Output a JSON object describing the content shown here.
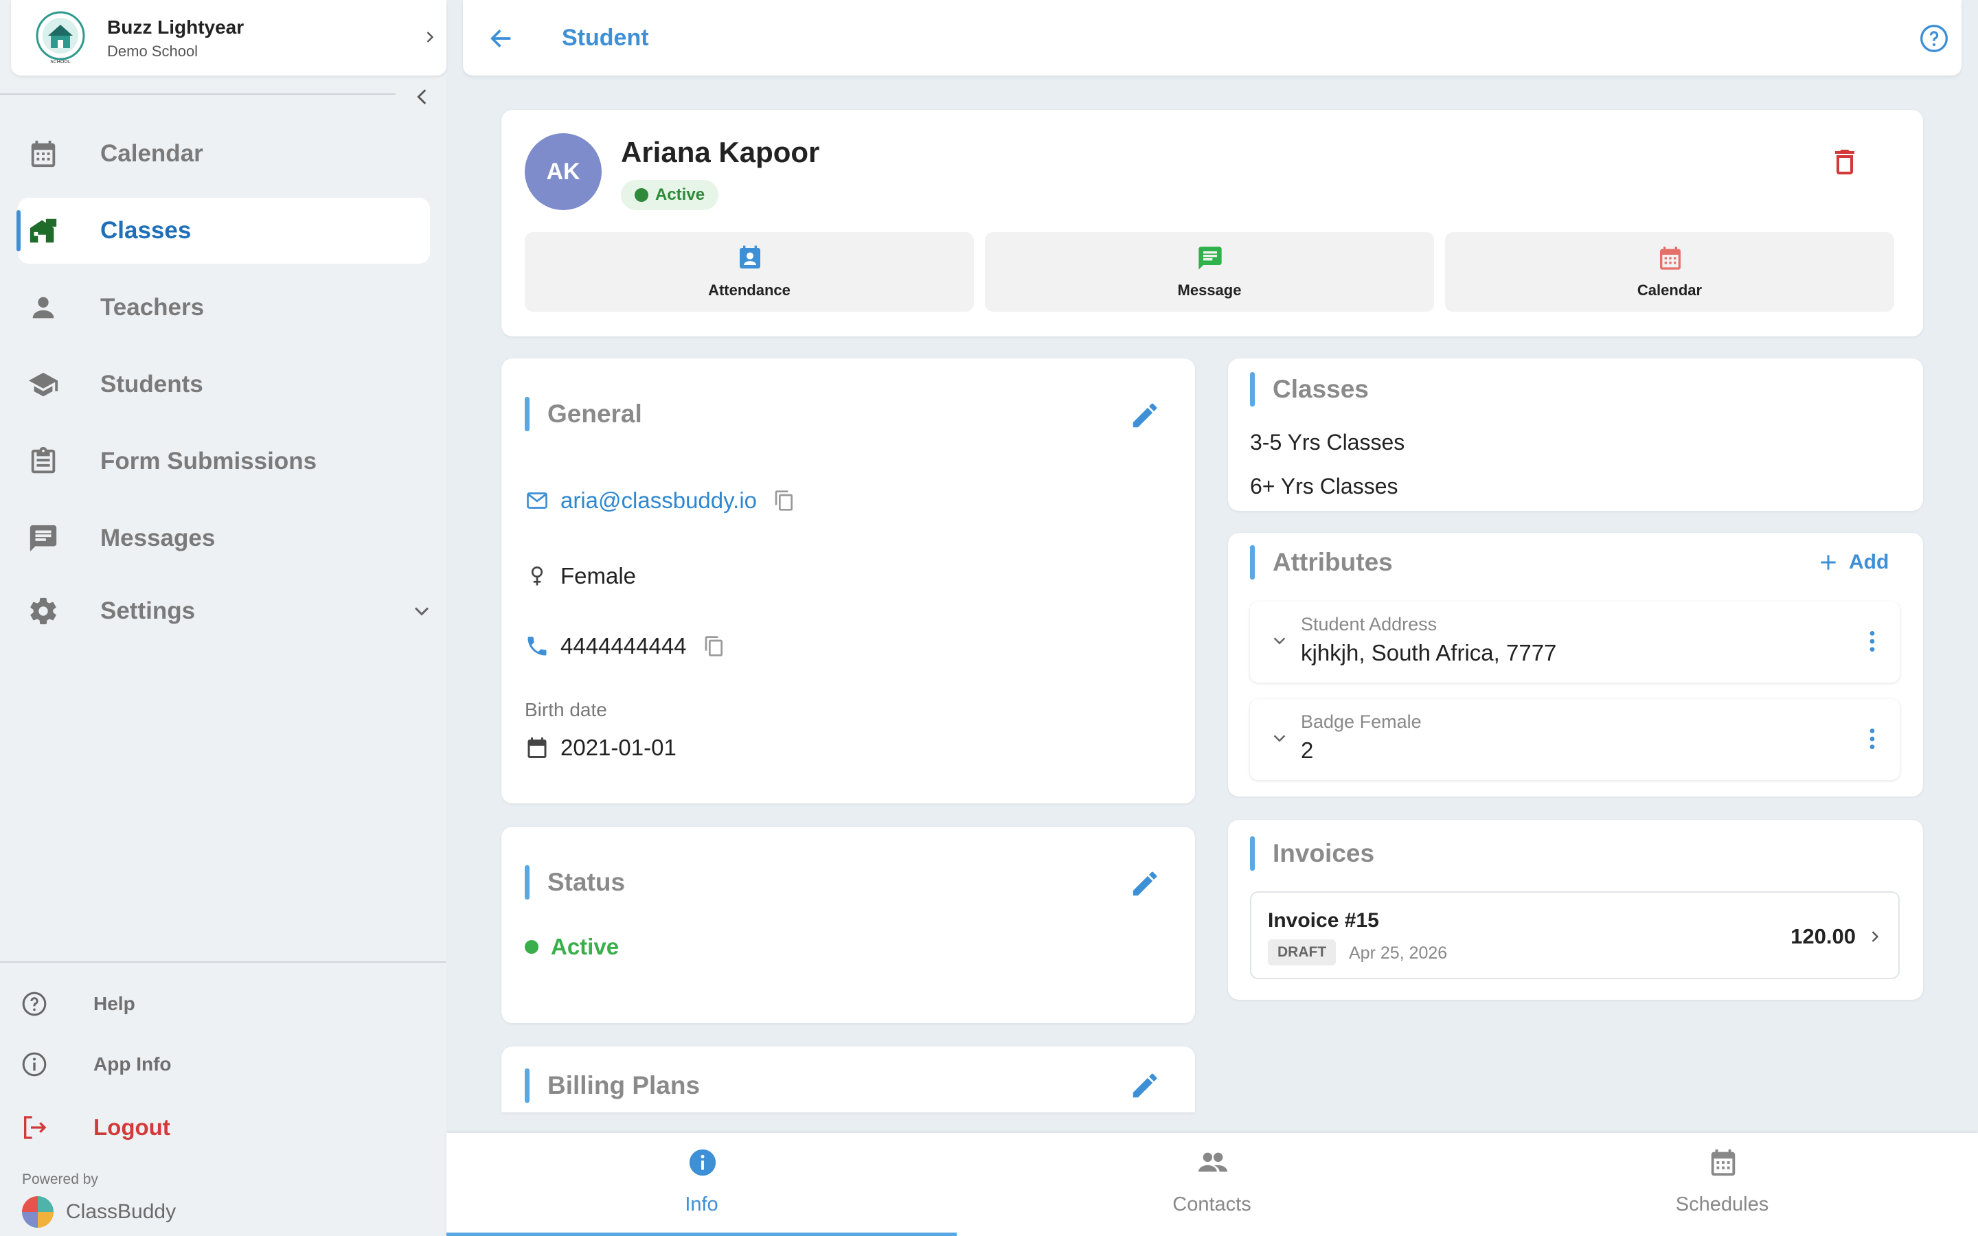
{
  "colors": {
    "accent": "#3d8fd6",
    "active_green": "#3aae4a",
    "danger": "#d23a3a",
    "avatar_bg": "#7e8ccc"
  },
  "sidebar": {
    "school_name": "Buzz Lightyear",
    "school_sub": "Demo School",
    "logo_text": "SCHOOL",
    "nav": [
      {
        "label": "Calendar",
        "icon": "calendar-icon"
      },
      {
        "label": "Classes",
        "icon": "classes-home-icon",
        "active": true
      },
      {
        "label": "Teachers",
        "icon": "person-icon"
      },
      {
        "label": "Students",
        "icon": "graduation-cap-icon"
      },
      {
        "label": "Form Submissions",
        "icon": "clipboard-icon"
      },
      {
        "label": "Messages",
        "icon": "message-icon"
      },
      {
        "label": "Settings",
        "icon": "gear-icon"
      }
    ],
    "footer": {
      "help": "Help",
      "app_info": "App Info",
      "logout": "Logout",
      "powered_by": "Powered by",
      "brand": "ClassBuddy"
    }
  },
  "topbar": {
    "title": "Student"
  },
  "profile": {
    "initials": "AK",
    "name": "Ariana Kapoor",
    "status": "Active",
    "actions": [
      {
        "label": "Attendance",
        "icon": "attendance-icon"
      },
      {
        "label": "Message",
        "icon": "message-icon"
      },
      {
        "label": "Calendar",
        "icon": "calendar-icon"
      }
    ]
  },
  "general": {
    "title": "General",
    "email": "aria@classbuddy.io",
    "gender": "Female",
    "phone": "4444444444",
    "birth_label": "Birth date",
    "birth_date": "2021-01-01"
  },
  "status_card": {
    "title": "Status",
    "value": "Active"
  },
  "billing": {
    "title": "Billing Plans"
  },
  "classes": {
    "title": "Classes",
    "items": [
      "3-5 Yrs Classes",
      "6+ Yrs Classes"
    ]
  },
  "attributes": {
    "title": "Attributes",
    "add_label": "Add",
    "items": [
      {
        "name": "Student Address",
        "value": "kjhkjh, South Africa, 7777"
      },
      {
        "name": "Badge Female",
        "value": "2"
      }
    ]
  },
  "invoices": {
    "title": "Invoices",
    "items": [
      {
        "title": "Invoice #15",
        "badge": "DRAFT",
        "date": "Apr 25, 2026",
        "amount": "120.00"
      }
    ]
  },
  "tabs": [
    {
      "label": "Info",
      "icon": "info-icon",
      "active": true
    },
    {
      "label": "Contacts",
      "icon": "people-icon"
    },
    {
      "label": "Schedules",
      "icon": "calendar-icon"
    }
  ]
}
